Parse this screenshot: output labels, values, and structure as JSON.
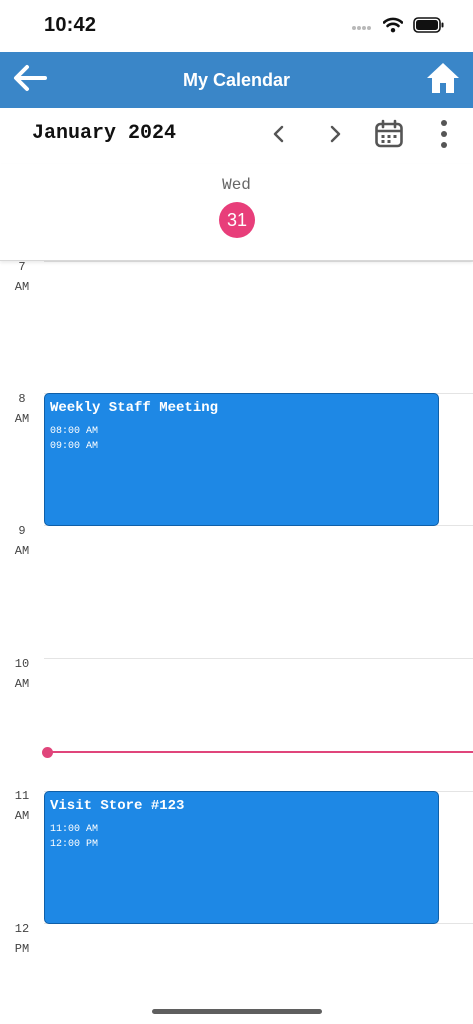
{
  "status_bar": {
    "time": "10:42",
    "icons": [
      "signal-dots-icon",
      "wifi-icon",
      "battery-icon"
    ]
  },
  "app_bar": {
    "title": "My Calendar",
    "back_icon": "arrow-left-icon",
    "home_icon": "home-icon",
    "color": "#3a86c8"
  },
  "toolbar": {
    "month": "January 2024",
    "icons": [
      "chevron-left-icon",
      "chevron-right-icon",
      "calendar-icon",
      "more-vertical-icon"
    ]
  },
  "day": {
    "weekday": "Wed",
    "date": "31",
    "date_color": "#e83e7a"
  },
  "hours": [
    {
      "num": "7",
      "ampm": "AM"
    },
    {
      "num": "8",
      "ampm": "AM"
    },
    {
      "num": "9",
      "ampm": "AM"
    },
    {
      "num": "10",
      "ampm": "AM"
    },
    {
      "num": "11",
      "ampm": "AM"
    },
    {
      "num": "12",
      "ampm": "PM"
    }
  ],
  "events": [
    {
      "title": "Weekly Staff Meeting",
      "start": "08:00 AM",
      "end": "09:00 AM"
    },
    {
      "title": "Visit Store #123",
      "start": "11:00 AM",
      "end": "12:00 PM"
    }
  ],
  "event_color": "#1e88e5",
  "now_indicator_color": "#e0457b"
}
